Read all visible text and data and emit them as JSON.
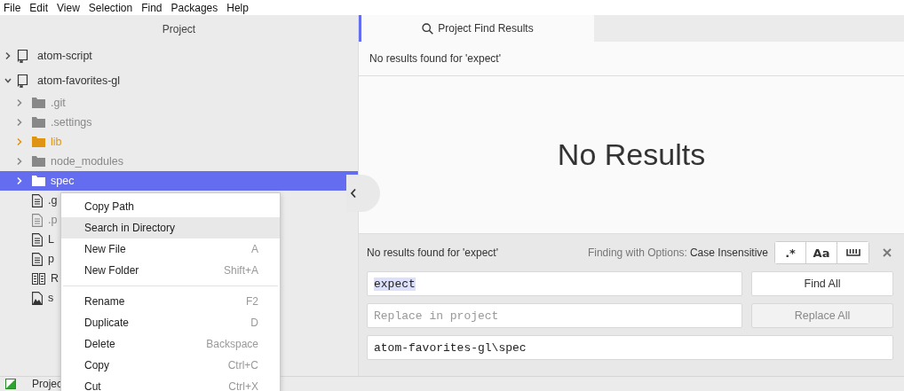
{
  "menu_bar": [
    "File",
    "Edit",
    "View",
    "Selection",
    "Find",
    "Packages",
    "Help"
  ],
  "project_panel": {
    "title": "Project",
    "tree": [
      {
        "name": "atom-script",
        "kind": "project",
        "expanded": false,
        "selected": false
      },
      {
        "name": "atom-favorites-gl",
        "kind": "project",
        "expanded": true,
        "selected": false,
        "children": [
          {
            "name": ".git",
            "kind": "folder",
            "expanded": false,
            "selected": false,
            "color": "#888888"
          },
          {
            "name": ".settings",
            "kind": "folder",
            "expanded": false,
            "selected": false,
            "color": "#888888"
          },
          {
            "name": "lib",
            "kind": "folder",
            "expanded": false,
            "selected": false,
            "color": "#e09414"
          },
          {
            "name": "node_modules",
            "kind": "folder",
            "expanded": false,
            "selected": false,
            "color": "#888888"
          },
          {
            "name": "spec",
            "kind": "folder",
            "expanded": false,
            "selected": true
          },
          {
            "name": ".g",
            "kind": "file",
            "selected": false
          },
          {
            "name": ".p",
            "kind": "file",
            "selected": false,
            "color": "#888888"
          },
          {
            "name": "L",
            "kind": "file",
            "selected": false
          },
          {
            "name": "p",
            "kind": "file",
            "selected": false
          },
          {
            "name": "R",
            "kind": "readme",
            "selected": false
          },
          {
            "name": "s",
            "kind": "image",
            "selected": false
          }
        ]
      }
    ]
  },
  "context_menu": {
    "groups": [
      [
        {
          "label": "Copy Path",
          "selected": false
        },
        {
          "label": "Search in Directory",
          "selected": true
        },
        {
          "label": "New File",
          "shortcut": "A",
          "selected": false
        },
        {
          "label": "New Folder",
          "shortcut": "Shift+A",
          "selected": false
        }
      ],
      [
        {
          "label": "Rename",
          "shortcut": "F2",
          "selected": false
        },
        {
          "label": "Duplicate",
          "shortcut": "D",
          "selected": false
        },
        {
          "label": "Delete",
          "shortcut": "Backspace",
          "selected": false
        },
        {
          "label": "Copy",
          "shortcut": "Ctrl+C",
          "selected": false
        },
        {
          "label": "Cut",
          "shortcut": "Ctrl+X",
          "selected": false
        }
      ]
    ]
  },
  "results_pane": {
    "tabs": [
      {
        "label": "Project Find Results",
        "selected": true
      }
    ],
    "summary": "No results found for 'expect'",
    "empty_message": "No Results"
  },
  "find_panel": {
    "summary": "No results found for 'expect'",
    "options_label": "Finding with Options:",
    "options_value": "Case Insensitive",
    "options": [
      {
        "kind": "text",
        "label": ".*",
        "selected": false
      },
      {
        "kind": "text",
        "label": "Aa",
        "selected": false
      },
      {
        "kind": "whole-word",
        "selected": false
      }
    ],
    "find_field": {
      "value": "expect",
      "highlighted": true
    },
    "find_button": {
      "label": "Find All",
      "disabled": false
    },
    "replace_field": {
      "placeholder": "Replace in project"
    },
    "replace_button": {
      "label": "Replace All",
      "disabled": true
    },
    "path_field": {
      "value": "atom-favorites-gl\\spec"
    }
  },
  "status_bar": {
    "label": "Projec"
  }
}
